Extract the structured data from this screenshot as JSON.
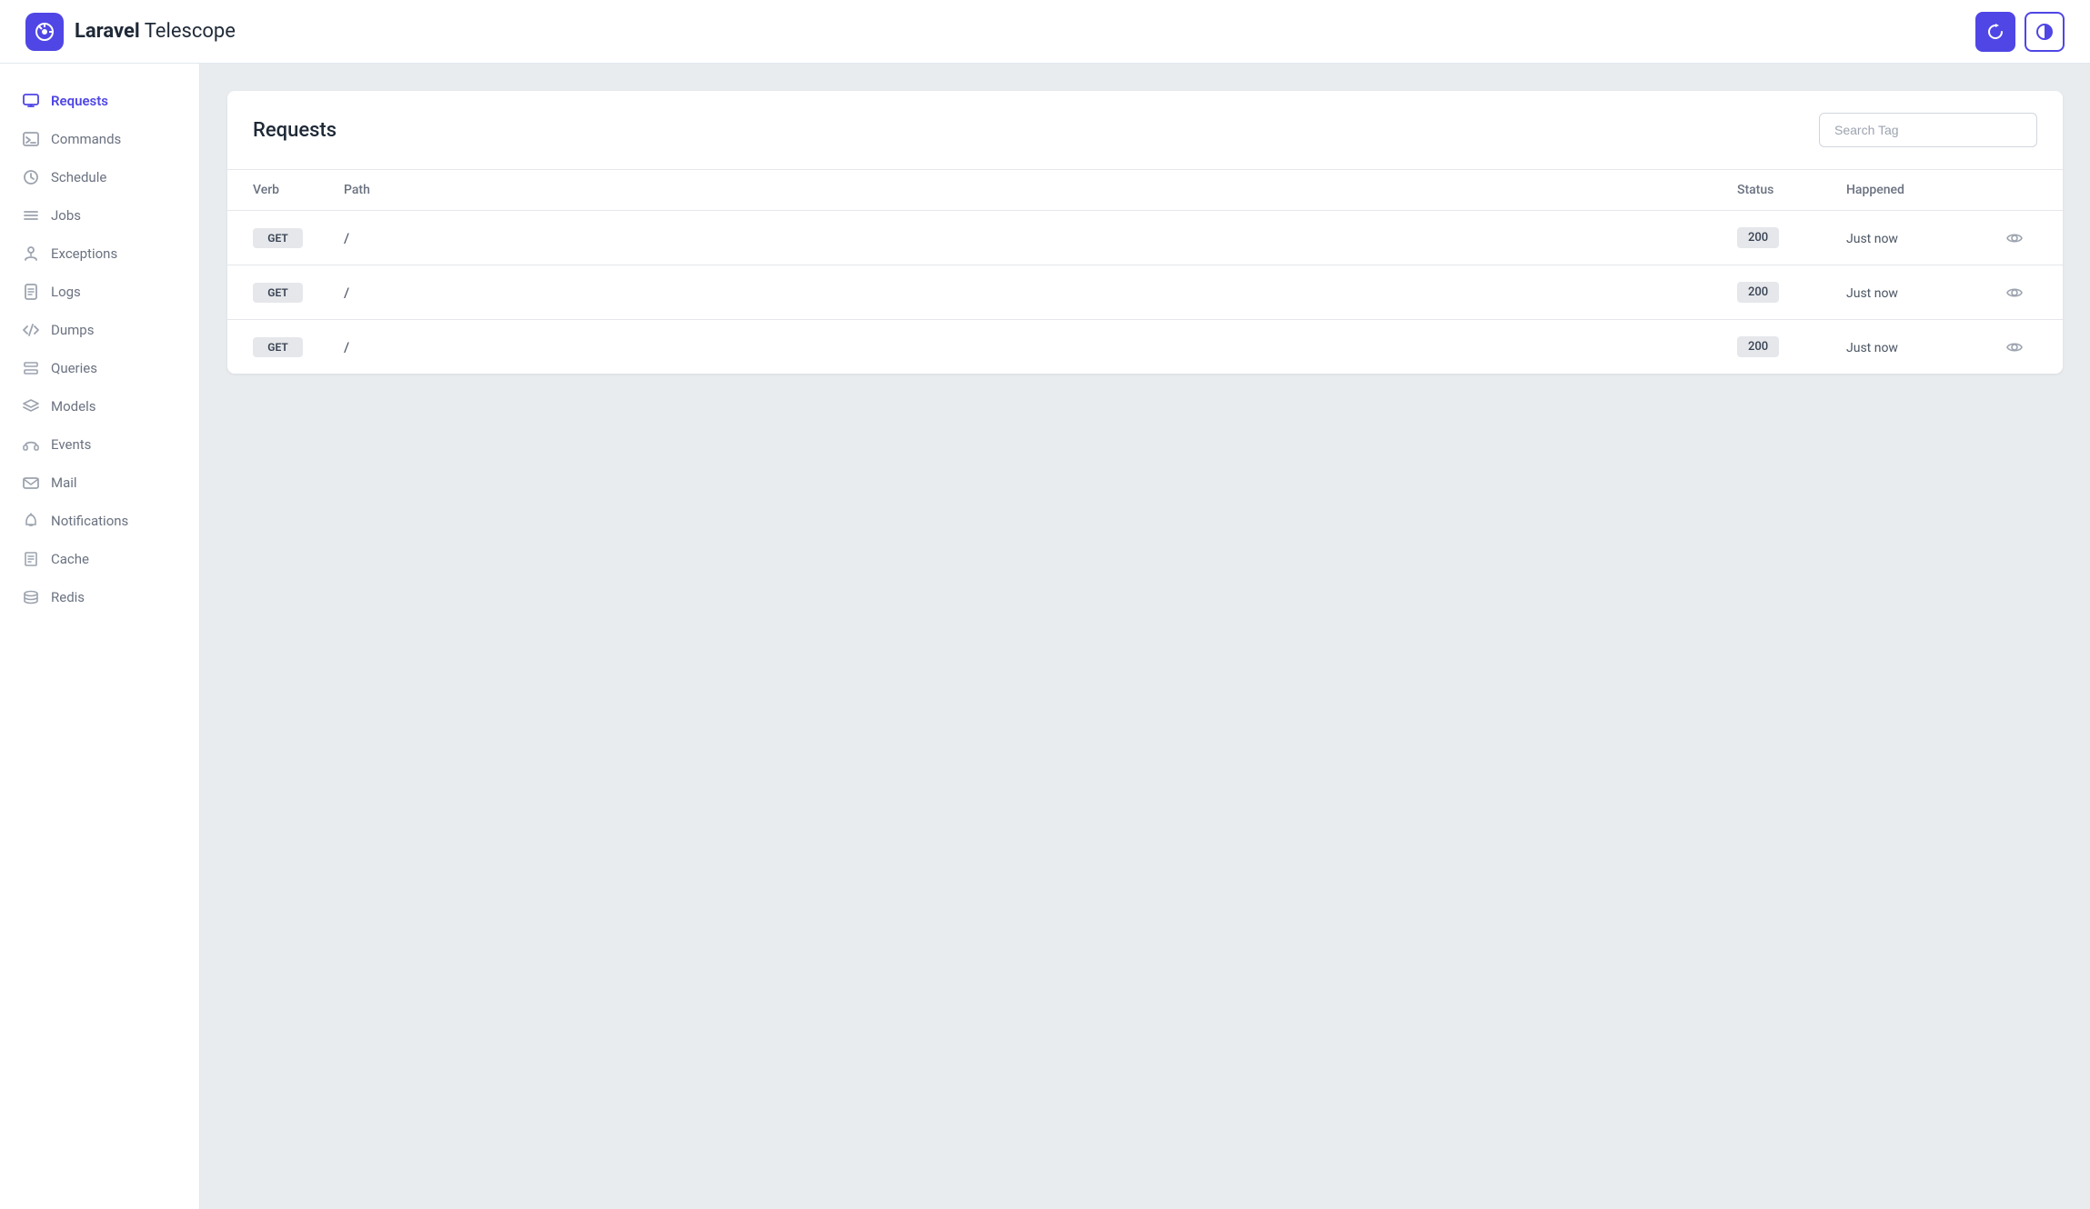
{
  "app": {
    "name_bold": "Laravel",
    "name_regular": "Telescope"
  },
  "header": {
    "refresh_label": "↻",
    "theme_label": "◑"
  },
  "sidebar": {
    "items": [
      {
        "id": "requests",
        "label": "Requests",
        "icon": "monitor-icon",
        "active": true
      },
      {
        "id": "commands",
        "label": "Commands",
        "icon": "terminal-icon",
        "active": false
      },
      {
        "id": "schedule",
        "label": "Schedule",
        "icon": "clock-icon",
        "active": false
      },
      {
        "id": "jobs",
        "label": "Jobs",
        "icon": "list-icon",
        "active": false
      },
      {
        "id": "exceptions",
        "label": "Exceptions",
        "icon": "person-icon",
        "active": false
      },
      {
        "id": "logs",
        "label": "Logs",
        "icon": "file-icon",
        "active": false
      },
      {
        "id": "dumps",
        "label": "Dumps",
        "icon": "code-icon",
        "active": false
      },
      {
        "id": "queries",
        "label": "Queries",
        "icon": "rows-icon",
        "active": false
      },
      {
        "id": "models",
        "label": "Models",
        "icon": "layers-icon",
        "active": false
      },
      {
        "id": "events",
        "label": "Events",
        "icon": "headphones-icon",
        "active": false
      },
      {
        "id": "mail",
        "label": "Mail",
        "icon": "envelope-icon",
        "active": false
      },
      {
        "id": "notifications",
        "label": "Notifications",
        "icon": "bell-icon",
        "active": false
      },
      {
        "id": "cache",
        "label": "Cache",
        "icon": "doc-icon",
        "active": false
      },
      {
        "id": "redis",
        "label": "Redis",
        "icon": "stack-icon",
        "active": false
      }
    ]
  },
  "main": {
    "title": "Requests",
    "search_placeholder": "Search Tag",
    "table": {
      "columns": [
        "Verb",
        "Path",
        "Status",
        "Happened",
        ""
      ],
      "rows": [
        {
          "verb": "GET",
          "path": "/",
          "status": "200",
          "happened": "Just now"
        },
        {
          "verb": "GET",
          "path": "/",
          "status": "200",
          "happened": "Just now"
        },
        {
          "verb": "GET",
          "path": "/",
          "status": "200",
          "happened": "Just now"
        }
      ]
    }
  },
  "colors": {
    "accent": "#4f46e5",
    "badge_bg": "#e5e7eb",
    "active_text": "#4f46e5"
  }
}
